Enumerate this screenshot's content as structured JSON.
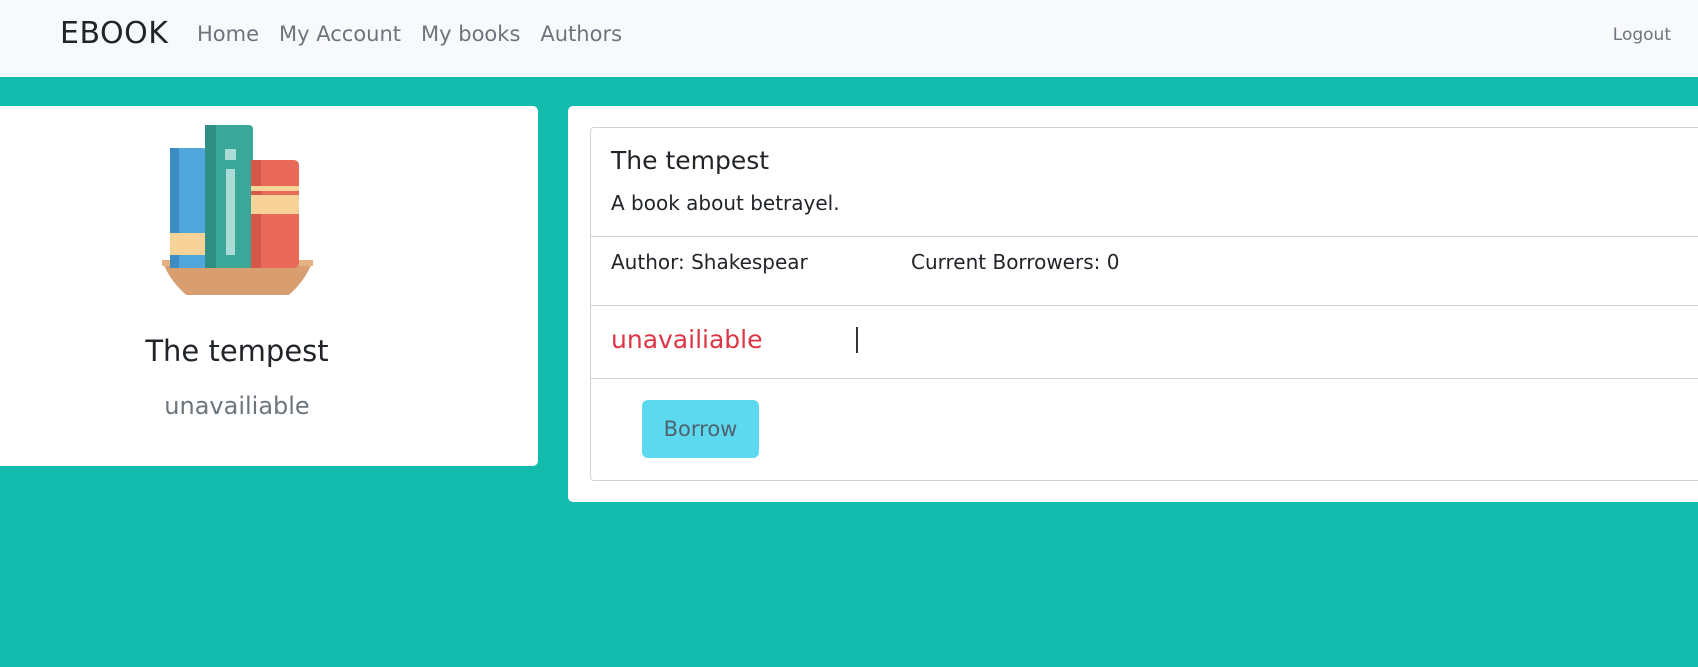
{
  "navbar": {
    "brand": "EBOOK",
    "links": [
      "Home",
      "My Account",
      "My books",
      "Authors"
    ],
    "logout": "Logout"
  },
  "left_card": {
    "icon": "books-illustration",
    "title": "The tempest",
    "status": "unavailiable"
  },
  "book_detail": {
    "title": "The tempest",
    "description": "A book about betrayel.",
    "author": "Author: Shakespear",
    "borrowers": "Current Borrowers: 0",
    "status": "unavailiable",
    "borrow_label": "Borrow"
  },
  "colors": {
    "background": "#12bbac",
    "navbar": "#f8f9fa",
    "status_danger": "#dc3545",
    "button_info": "#5dd9ef"
  }
}
